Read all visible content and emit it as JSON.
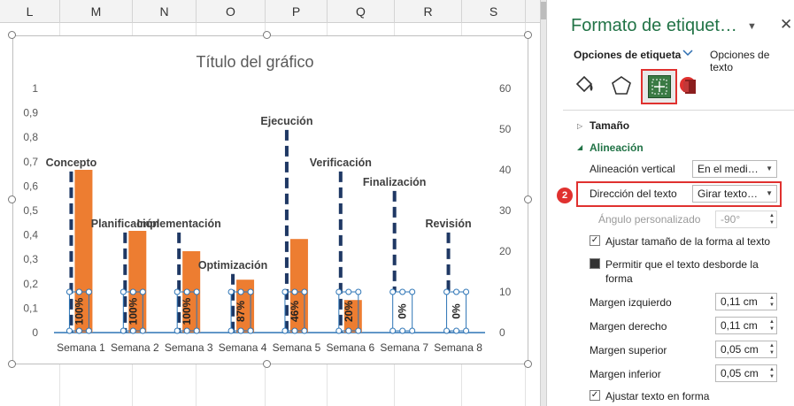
{
  "sheet": {
    "columns": [
      "L",
      "M",
      "N",
      "O",
      "P",
      "Q",
      "R",
      "S"
    ]
  },
  "chart_data": {
    "type": "bar",
    "title": "Título del gráfico",
    "categories": [
      "Semana 1",
      "Semana 2",
      "Semana 3",
      "Semana 4",
      "Semana 5",
      "Semana 6",
      "Semana 7",
      "Semana 8"
    ],
    "series": [
      {
        "axis": "right",
        "values": [
          40,
          25,
          20,
          13,
          23,
          8,
          0,
          0
        ],
        "color": "#ed7d31"
      },
      {
        "axis": "left",
        "values": [
          0.66,
          0.41,
          0.41,
          0.24,
          0.83,
          0.66,
          0.58,
          0.41
        ],
        "color": "#1f3864",
        "style": "dashed-line"
      }
    ],
    "phase_labels": [
      "Concepto",
      "Planificación",
      "Implementación",
      "Optimización",
      "Ejecución",
      "Verificación",
      "Finalización",
      "Revisión"
    ],
    "percent_labels": [
      "100%",
      "100%",
      "100%",
      "87%",
      "46%",
      "20%",
      "0%",
      "0%"
    ],
    "left_axis": {
      "min": 0,
      "max": 1,
      "ticks": [
        "0",
        "0,1",
        "0,2",
        "0,3",
        "0,4",
        "0,5",
        "0,6",
        "0,7",
        "0,8",
        "0,9",
        "1"
      ]
    },
    "right_axis": {
      "min": 0,
      "max": 60,
      "ticks": [
        "0",
        "10",
        "20",
        "30",
        "40",
        "50",
        "60"
      ]
    }
  },
  "pane": {
    "title": "Formato de etiquet…",
    "tab_label_options": "Opciones de etiqueta",
    "tab_text_options": "Opciones de texto",
    "badge1": "1",
    "badge2": "2",
    "section_size": "Tamaño",
    "section_alignment": "Alineación",
    "vertical_alignment_label": "Alineación vertical",
    "vertical_alignment_value": "En el medi…",
    "text_direction_label": "Dirección del texto",
    "text_direction_value": "Girar texto…",
    "custom_angle_label": "Ángulo personalizado",
    "custom_angle_value": "-90°",
    "resize_shape_label": "Ajustar tamaño de la forma al texto",
    "overflow_label_line1": "Permitir que el texto desborde la",
    "overflow_label_line2": "forma",
    "margin_left_label": "Margen izquierdo",
    "margin_left_value": "0,11 cm",
    "margin_right_label": "Margen derecho",
    "margin_right_value": "0,11 cm",
    "margin_top_label": "Margen superior",
    "margin_top_value": "0,05 cm",
    "margin_bottom_label": "Margen inferior",
    "margin_bottom_value": "0,05 cm",
    "wrap_text_label": "Ajustar texto en forma"
  }
}
